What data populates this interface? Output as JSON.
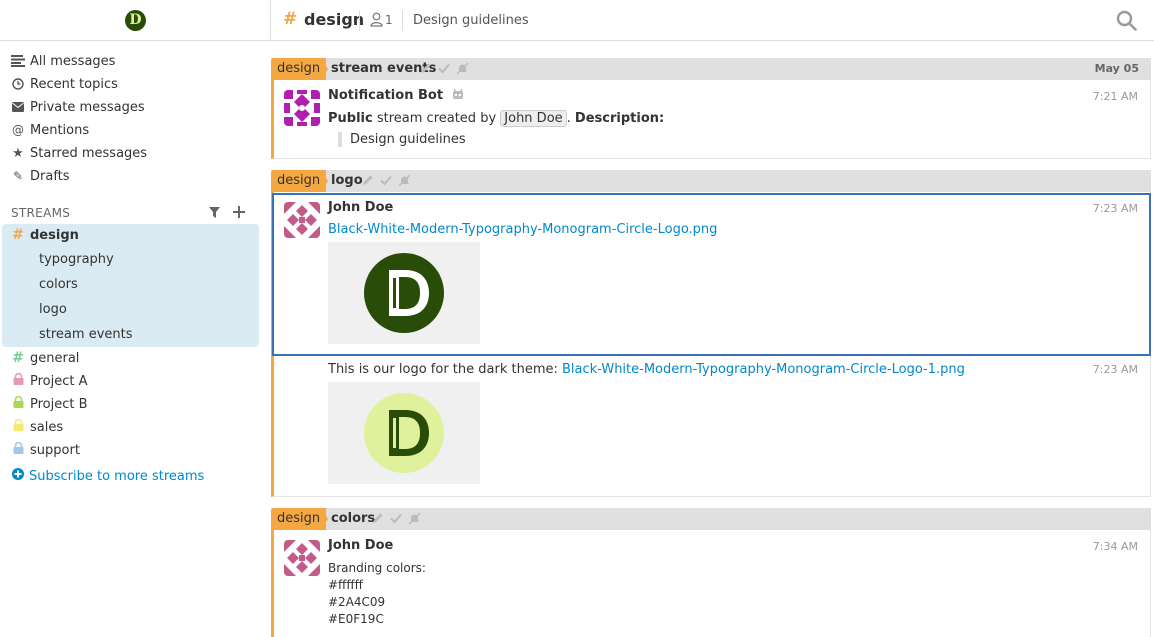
{
  "header": {
    "logo_letter": "D",
    "stream_hash": "#",
    "stream_name": "design",
    "subscriber_count": "1",
    "stream_description": "Design guidelines"
  },
  "sidebar": {
    "nav": [
      {
        "label": "All messages",
        "icon": "all-messages-icon"
      },
      {
        "label": "Recent topics",
        "icon": "clock-icon"
      },
      {
        "label": "Private messages",
        "icon": "envelope-icon"
      },
      {
        "label": "Mentions",
        "icon": "at-icon"
      },
      {
        "label": "Starred messages",
        "icon": "star-icon"
      },
      {
        "label": "Drafts",
        "icon": "pencil-icon"
      }
    ],
    "streams_title": "STREAMS",
    "streams": [
      {
        "name": "design",
        "color": "#f5a742",
        "icon": "hash"
      },
      {
        "name": "general",
        "color": "#76ce90",
        "icon": "hash"
      },
      {
        "name": "Project A",
        "color": "#e79ab5",
        "icon": "lock"
      },
      {
        "name": "Project B",
        "color": "#a6dc4c",
        "icon": "lock"
      },
      {
        "name": "sales",
        "color": "#f6e96f",
        "icon": "lock"
      },
      {
        "name": "support",
        "color": "#a6c7e5",
        "icon": "lock"
      }
    ],
    "topics": [
      "typography",
      "colors",
      "logo",
      "stream events"
    ],
    "subscribe_label": "Subscribe to more streams"
  },
  "messages": {
    "group1": {
      "stream": "design",
      "topic": "stream events",
      "date": "May 05",
      "sender": "Notification Bot",
      "time": "7:21 AM",
      "line_bold1": "Public",
      "line_mid": " stream created by ",
      "mention": "John Doe",
      "line_dot": ". ",
      "line_bold2": "Description:",
      "quote": "Design guidelines"
    },
    "group2": {
      "stream": "design",
      "topic": "logo",
      "sender": "John Doe",
      "time1": "7:23 AM",
      "link1": "Black-White-Modern-Typography-Monogram-Circle-Logo.png",
      "time2": "7:23 AM",
      "text2": "This is our logo for the dark theme: ",
      "link2": "Black-White-Modern-Typography-Monogram-Circle-Logo-1.png"
    },
    "group3": {
      "stream": "design",
      "topic": "colors",
      "sender": "John Doe",
      "time": "7:34 AM",
      "lines": [
        "Branding colors:",
        "#ffffff",
        "#2A4C09",
        "#E0F19C"
      ]
    }
  },
  "colors": {
    "accent_stream": "#f5a742",
    "selected_outline": "#3c71b6",
    "link": "#0088cc",
    "logo_dark": "#2A4C09",
    "logo_light": "#E0F19C"
  }
}
